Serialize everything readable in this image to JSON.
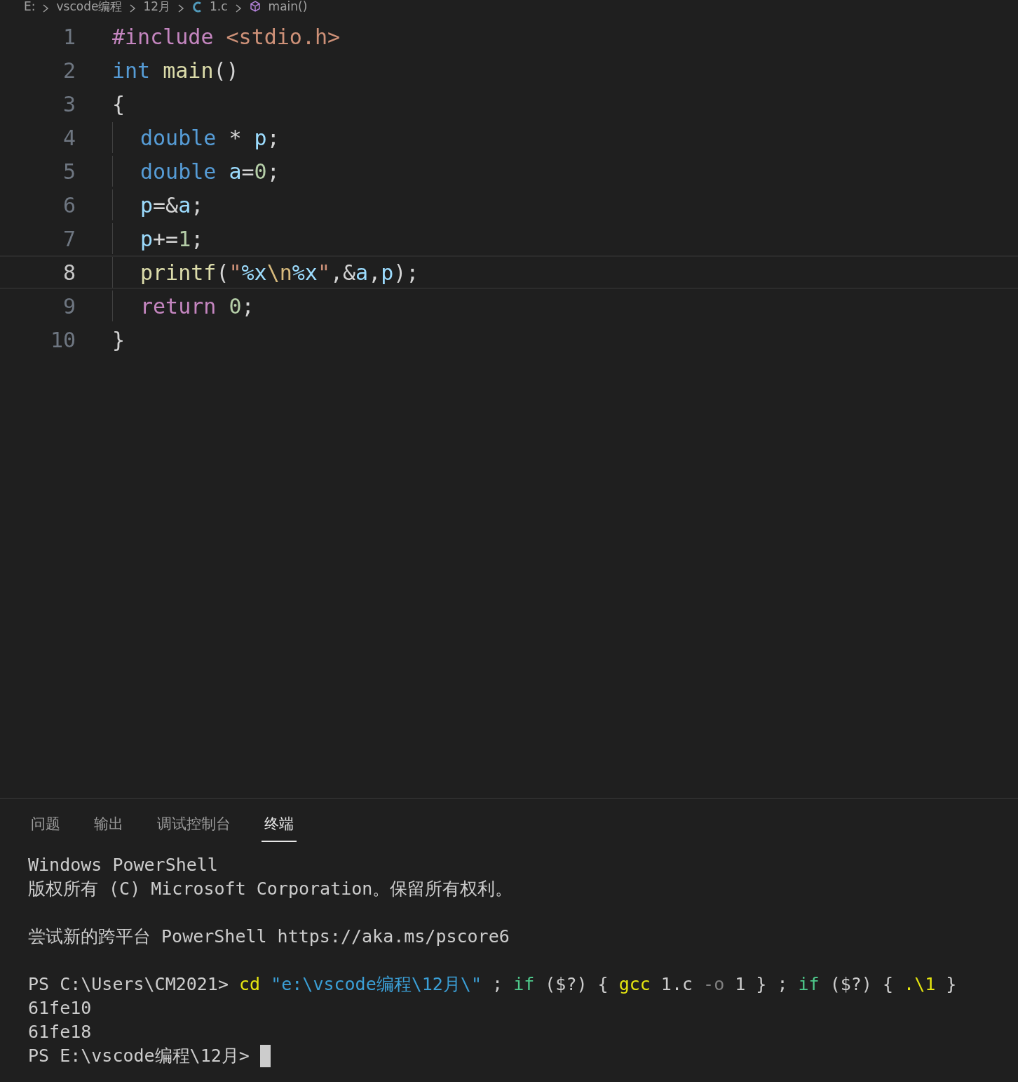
{
  "breadcrumb": [
    {
      "kind": "text",
      "label": "E:"
    },
    {
      "kind": "text",
      "label": "vscode编程"
    },
    {
      "kind": "text",
      "label": "12月"
    },
    {
      "kind": "c-file",
      "label": "1.c"
    },
    {
      "kind": "symbol",
      "label": "main()"
    }
  ],
  "editor": {
    "lines": [
      {
        "number": "1",
        "indented": false,
        "current": false,
        "tokens": [
          {
            "t": "#include ",
            "color": "#c586c0"
          },
          {
            "t": "<stdio.h>",
            "color": "#ce9178"
          }
        ]
      },
      {
        "number": "2",
        "indented": false,
        "current": false,
        "tokens": [
          {
            "t": "int ",
            "color": "#569cd6"
          },
          {
            "t": "main",
            "color": "#dcdcaa"
          },
          {
            "t": "()",
            "color": "#d4d4d4"
          }
        ]
      },
      {
        "number": "3",
        "indented": false,
        "current": false,
        "tokens": [
          {
            "t": "{",
            "color": "#d4d4d4"
          }
        ]
      },
      {
        "number": "4",
        "indented": true,
        "current": false,
        "tokens": [
          {
            "t": "double",
            "color": "#569cd6"
          },
          {
            "t": " * ",
            "color": "#d4d4d4"
          },
          {
            "t": "p",
            "color": "#9cdcfe"
          },
          {
            "t": ";",
            "color": "#d4d4d4"
          }
        ]
      },
      {
        "number": "5",
        "indented": true,
        "current": false,
        "tokens": [
          {
            "t": "double ",
            "color": "#569cd6"
          },
          {
            "t": "a",
            "color": "#9cdcfe"
          },
          {
            "t": "=",
            "color": "#d4d4d4"
          },
          {
            "t": "0",
            "color": "#b5cea8"
          },
          {
            "t": ";",
            "color": "#d4d4d4"
          }
        ]
      },
      {
        "number": "6",
        "indented": true,
        "current": false,
        "tokens": [
          {
            "t": "p",
            "color": "#9cdcfe"
          },
          {
            "t": "=&",
            "color": "#d4d4d4"
          },
          {
            "t": "a",
            "color": "#9cdcfe"
          },
          {
            "t": ";",
            "color": "#d4d4d4"
          }
        ]
      },
      {
        "number": "7",
        "indented": true,
        "current": false,
        "tokens": [
          {
            "t": "p",
            "color": "#9cdcfe"
          },
          {
            "t": "+=",
            "color": "#d4d4d4"
          },
          {
            "t": "1",
            "color": "#b5cea8"
          },
          {
            "t": ";",
            "color": "#d4d4d4"
          }
        ]
      },
      {
        "number": "8",
        "indented": true,
        "current": true,
        "tokens": [
          {
            "t": "printf",
            "color": "#dcdcaa"
          },
          {
            "t": "(",
            "color": "#d4d4d4"
          },
          {
            "t": "\"",
            "color": "#ce9178"
          },
          {
            "t": "%x",
            "color": "#9cdcfe"
          },
          {
            "t": "\\n",
            "color": "#d7ba7d"
          },
          {
            "t": "%x",
            "color": "#9cdcfe"
          },
          {
            "t": "\"",
            "color": "#ce9178"
          },
          {
            "t": ",&",
            "color": "#d4d4d4"
          },
          {
            "t": "a",
            "color": "#9cdcfe"
          },
          {
            "t": ",",
            "color": "#d4d4d4"
          },
          {
            "t": "p",
            "color": "#9cdcfe"
          },
          {
            "t": ");",
            "color": "#d4d4d4"
          }
        ]
      },
      {
        "number": "9",
        "indented": true,
        "current": false,
        "tokens": [
          {
            "t": "return ",
            "color": "#c586c0"
          },
          {
            "t": "0",
            "color": "#b5cea8"
          },
          {
            "t": ";",
            "color": "#d4d4d4"
          }
        ]
      },
      {
        "number": "10",
        "indented": false,
        "current": false,
        "tokens": [
          {
            "t": "}",
            "color": "#d4d4d4"
          }
        ]
      }
    ]
  },
  "panel": {
    "tabs": [
      {
        "label": "问题",
        "selected": false
      },
      {
        "label": "输出",
        "selected": false
      },
      {
        "label": "调试控制台",
        "selected": false
      },
      {
        "label": "终端",
        "selected": true
      }
    ],
    "terminal": {
      "blocks": [
        [
          {
            "tokens": [
              {
                "t": "Windows PowerShell",
                "color": "#cccccc"
              }
            ]
          },
          {
            "tokens": [
              {
                "t": "版权所有 (C) Microsoft Corporation。保留所有权利。",
                "color": "#cccccc"
              }
            ]
          }
        ],
        [
          {
            "tokens": [
              {
                "t": "尝试新的跨平台 PowerShell https://aka.ms/pscore6",
                "color": "#cccccc"
              }
            ]
          }
        ],
        [
          {
            "tokens": [
              {
                "t": "PS C:\\Users\\CM2021> ",
                "color": "#cccccc"
              },
              {
                "t": "cd ",
                "color": "#e5e510"
              },
              {
                "t": "\"e:\\vscode编程\\12月\\\"",
                "color": "#3b9fd6"
              },
              {
                "t": " ; ",
                "color": "#cccccc"
              },
              {
                "t": "if",
                "color": "#4ec98b"
              },
              {
                "t": " ($?) { ",
                "color": "#cccccc"
              },
              {
                "t": "gcc",
                "color": "#e5e510"
              },
              {
                "t": " 1.c ",
                "color": "#cccccc"
              },
              {
                "t": "-o",
                "color": "#808080"
              },
              {
                "t": " 1 } ; ",
                "color": "#cccccc"
              },
              {
                "t": "if",
                "color": "#4ec98b"
              },
              {
                "t": " ($?) { ",
                "color": "#cccccc"
              },
              {
                "t": ".\\1",
                "color": "#e5e510"
              },
              {
                "t": " }",
                "color": "#cccccc"
              }
            ],
            "cursor": false
          },
          {
            "tokens": [
              {
                "t": "61fe10",
                "color": "#cccccc"
              }
            ],
            "cursor": false
          },
          {
            "tokens": [
              {
                "t": "61fe18",
                "color": "#cccccc"
              }
            ],
            "cursor": false
          },
          {
            "tokens": [
              {
                "t": "PS E:\\vscode编程\\12月> ",
                "color": "#cccccc"
              }
            ],
            "cursor": true
          }
        ]
      ]
    }
  }
}
